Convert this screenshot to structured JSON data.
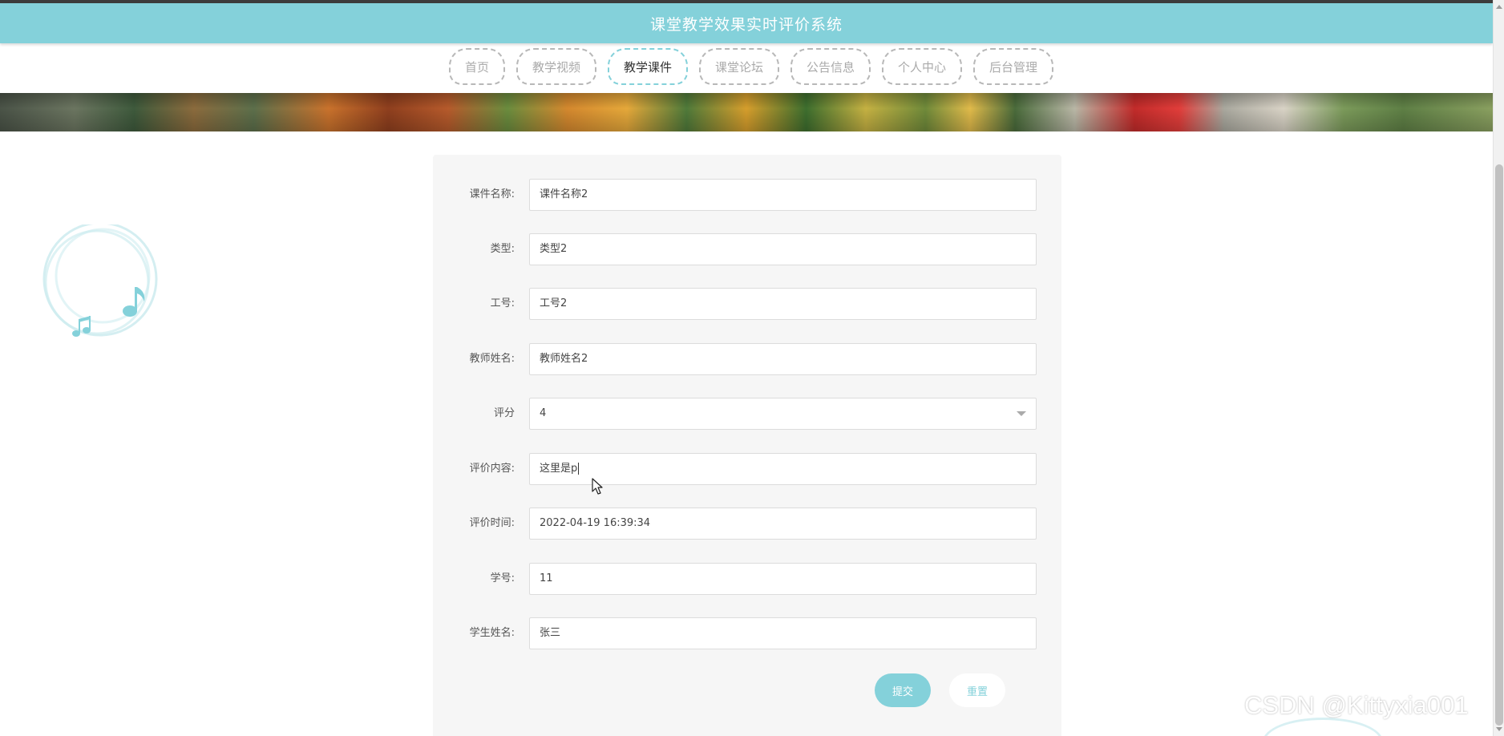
{
  "header": {
    "title": "课堂教学效果实时评价系统"
  },
  "nav": {
    "tabs": [
      {
        "label": "首页",
        "active": false
      },
      {
        "label": "教学视频",
        "active": false
      },
      {
        "label": "教学课件",
        "active": true
      },
      {
        "label": "课堂论坛",
        "active": false
      },
      {
        "label": "公告信息",
        "active": false
      },
      {
        "label": "个人中心",
        "active": false
      },
      {
        "label": "后台管理",
        "active": false
      }
    ]
  },
  "form": {
    "fields": [
      {
        "label": "课件名称:",
        "value": "课件名称2"
      },
      {
        "label": "类型:",
        "value": "类型2"
      },
      {
        "label": "工号:",
        "value": "工号2"
      },
      {
        "label": "教师姓名:",
        "value": "教师姓名2"
      },
      {
        "label": "评分",
        "value": "4"
      },
      {
        "label": "评价内容:",
        "value": "这里是p"
      },
      {
        "label": "评价时间:",
        "value": "2022-04-19 16:39:34"
      },
      {
        "label": "学号:",
        "value": "11"
      },
      {
        "label": "学生姓名:",
        "value": "张三"
      }
    ],
    "submit_label": "提交",
    "reset_label": "重置"
  },
  "watermark": "CSDN @Kittyxia001",
  "colors": {
    "accent": "#84d1da",
    "panel": "#f6f6f6",
    "inactive_tab_text": "#aaaaaa"
  },
  "icons": [
    "music-note-icon",
    "music-notes-icon",
    "mouse-cursor-icon",
    "dropdown-arrow-icon"
  ]
}
